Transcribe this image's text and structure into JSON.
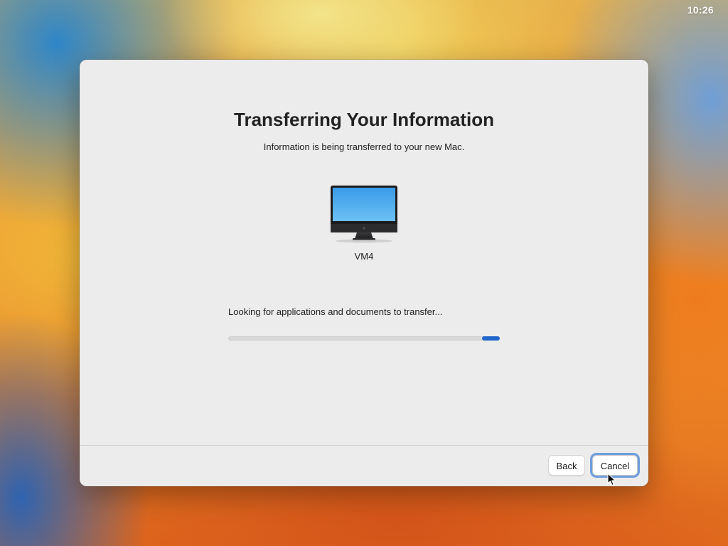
{
  "menubar": {
    "clock": "10:26"
  },
  "window": {
    "title": "Transferring Your Information",
    "subtitle": "Information is being transferred to your new Mac.",
    "device": {
      "icon": "imac-icon",
      "name": "VM4"
    },
    "status": "Looking for applications and documents to transfer...",
    "progress": {
      "indeterminate": true,
      "accent_color": "#2266cc"
    },
    "buttons": {
      "back_label": "Back",
      "cancel_label": "Cancel"
    }
  },
  "colors": {
    "focus_ring": "#6f9fdc",
    "window_background": "#ececec"
  }
}
